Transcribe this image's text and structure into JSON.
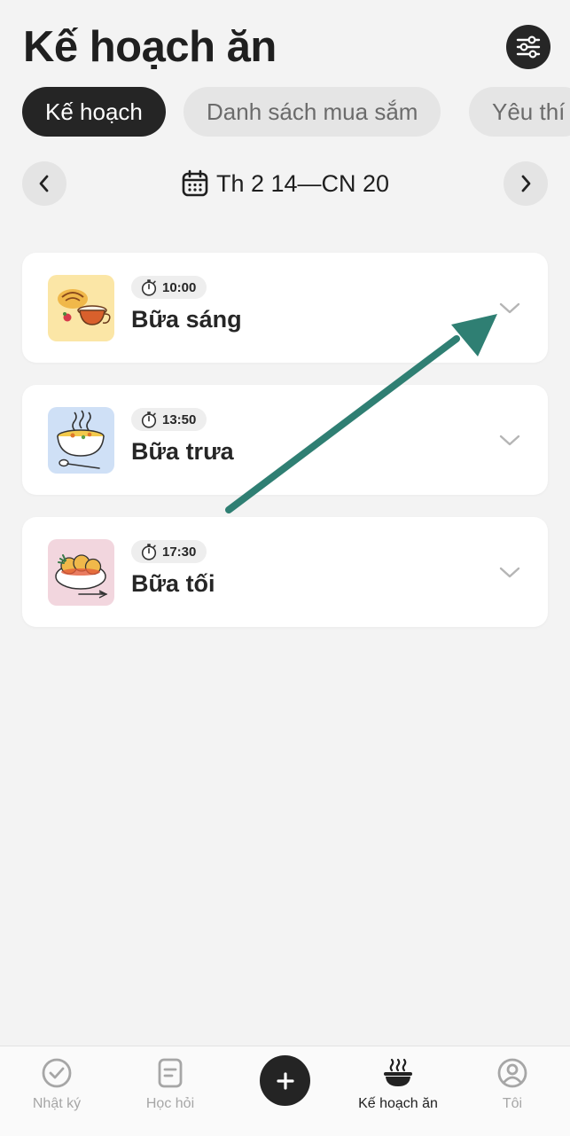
{
  "header": {
    "title": "Kế hoạch ăn"
  },
  "tabs": [
    {
      "label": "Kế hoạch",
      "active": true
    },
    {
      "label": "Danh sách mua sắm",
      "active": false
    },
    {
      "label": "Yêu thí",
      "active": false
    }
  ],
  "week": {
    "label": "Th 2 14—CN 20"
  },
  "meals": [
    {
      "time": "10:00",
      "name": "Bữa sáng",
      "thumb_color": "#fbe6a6",
      "icon": "breakfast-illustration"
    },
    {
      "time": "13:50",
      "name": "Bữa trưa",
      "thumb_color": "#cfe0f6",
      "icon": "soup-bowl-illustration"
    },
    {
      "time": "17:30",
      "name": "Bữa tối",
      "thumb_color": "#f2d6de",
      "icon": "dinner-plate-illustration"
    }
  ],
  "annotation": {
    "color": "#2f7f73"
  },
  "bottom_nav": [
    {
      "label": "Nhật ký",
      "icon": "check-circle-icon"
    },
    {
      "label": "Học hỏi",
      "icon": "document-icon"
    },
    {
      "label": "Kế hoạch ăn",
      "icon": "food-bowl-icon",
      "active": true
    },
    {
      "label": "Tôi",
      "icon": "profile-icon"
    }
  ]
}
